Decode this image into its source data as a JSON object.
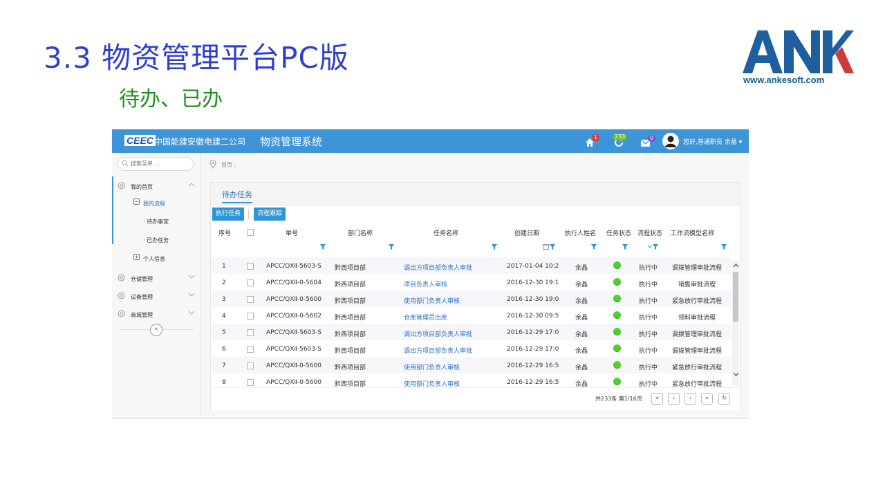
{
  "slide": {
    "title": "3.3 物资管理平台PC版",
    "subtitle": "待办、已办"
  },
  "logo": {
    "letters": "ANK",
    "url": "www.ankesoft.com",
    "colors": {
      "blue": "#1f5f9e",
      "red": "#d13a3a"
    }
  },
  "app": {
    "brand_mark": "CEEC",
    "company": "中国能建安徽电建二公司",
    "system_name": "物资管理系统",
    "accent": "#3d94d7",
    "notifications": {
      "home": "1",
      "tasks": "233",
      "mail": "0"
    },
    "greeting": "您好,普通职员 余晶",
    "icons": [
      "home-icon",
      "refresh-icon",
      "mail-icon",
      "user-avatar-icon",
      "caret-down-icon"
    ]
  },
  "sidebar": {
    "search_placeholder": "搜索菜单 ...",
    "items": [
      {
        "label": "我的首页",
        "icon": "gear-icon",
        "expanded": true
      },
      {
        "label": "我的流程",
        "icon": "minus-square-icon"
      },
      {
        "label": "· 待办事宜"
      },
      {
        "label": "· 已办任务"
      },
      {
        "label": "个人信息",
        "icon": "plus-square-icon"
      },
      {
        "label": "仓储管理",
        "icon": "gear-icon"
      },
      {
        "label": "设备管理",
        "icon": "gear-icon"
      },
      {
        "label": "商城管理",
        "icon": "gear-icon"
      }
    ]
  },
  "breadcrumb": {
    "text": "首页 :"
  },
  "main": {
    "tab_label": "待办任务",
    "buttons": {
      "execute": "执行任务",
      "trace": "流程跟踪"
    },
    "columns": [
      "序号",
      "单号",
      "部门名称",
      "任务名称",
      "创建日期",
      "执行人姓名",
      "任务状态",
      "流程状态",
      "工作流模型名称"
    ],
    "rows": [
      {
        "no": "1",
        "order": "APCC/QXⅡ-5603-S",
        "dept": "黔西项目部",
        "task": "调出方项目部负责人审批",
        "date": "2017-01-04 10:2",
        "executor": "余晶",
        "task_status": "ok",
        "flow_status": "执行中",
        "model": "调拨管理审批流程"
      },
      {
        "no": "2",
        "order": "APCC/QXⅡ-0-5604",
        "dept": "黔西项目部",
        "task": "项目负责人审核",
        "date": "2016-12-30 19:1",
        "executor": "余晶",
        "task_status": "ok",
        "flow_status": "执行中",
        "model": "销售审批流程"
      },
      {
        "no": "3",
        "order": "APCC/QXⅡ-0-5600",
        "dept": "黔西项目部",
        "task": "使用部门负责人审核",
        "date": "2016-12-30 19:0",
        "executor": "余晶",
        "task_status": "ok",
        "flow_status": "执行中",
        "model": "紧急放行审批流程"
      },
      {
        "no": "4",
        "order": "APCC/QXⅡ-0-5602",
        "dept": "黔西项目部",
        "task": "仓库管理员出库",
        "date": "2016-12-30 09:5",
        "executor": "余晶",
        "task_status": "ok",
        "flow_status": "执行中",
        "model": "领料审批流程"
      },
      {
        "no": "5",
        "order": "APCC/QXⅡ-5603-S",
        "dept": "黔西项目部",
        "task": "调出方项目部负责人审批",
        "date": "2016-12-29 17:0",
        "executor": "余晶",
        "task_status": "ok",
        "flow_status": "执行中",
        "model": "调拨管理审批流程"
      },
      {
        "no": "6",
        "order": "APCC/QXⅡ-5603-S",
        "dept": "黔西项目部",
        "task": "调出方项目部负责人审批",
        "date": "2016-12-29 17:0",
        "executor": "余晶",
        "task_status": "ok",
        "flow_status": "执行中",
        "model": "调拨管理审批流程"
      },
      {
        "no": "7",
        "order": "APCC/QXⅡ-0-5600",
        "dept": "黔西项目部",
        "task": "使用部门负责人审核",
        "date": "2016-12-29 16:5",
        "executor": "余晶",
        "task_status": "ok",
        "flow_status": "执行中",
        "model": "紧急放行审批流程"
      },
      {
        "no": "8",
        "order": "APCC/QXⅡ-0-5600",
        "dept": "黔西项目部",
        "task": "使用部门负责人审核",
        "date": "2016-12-29 16:5",
        "executor": "余晶",
        "task_status": "ok",
        "flow_status": "执行中",
        "model": "紧急放行审批流程"
      }
    ],
    "status_color": "#4fd12c",
    "pagination": {
      "info": "共233条 第1/16页"
    }
  }
}
